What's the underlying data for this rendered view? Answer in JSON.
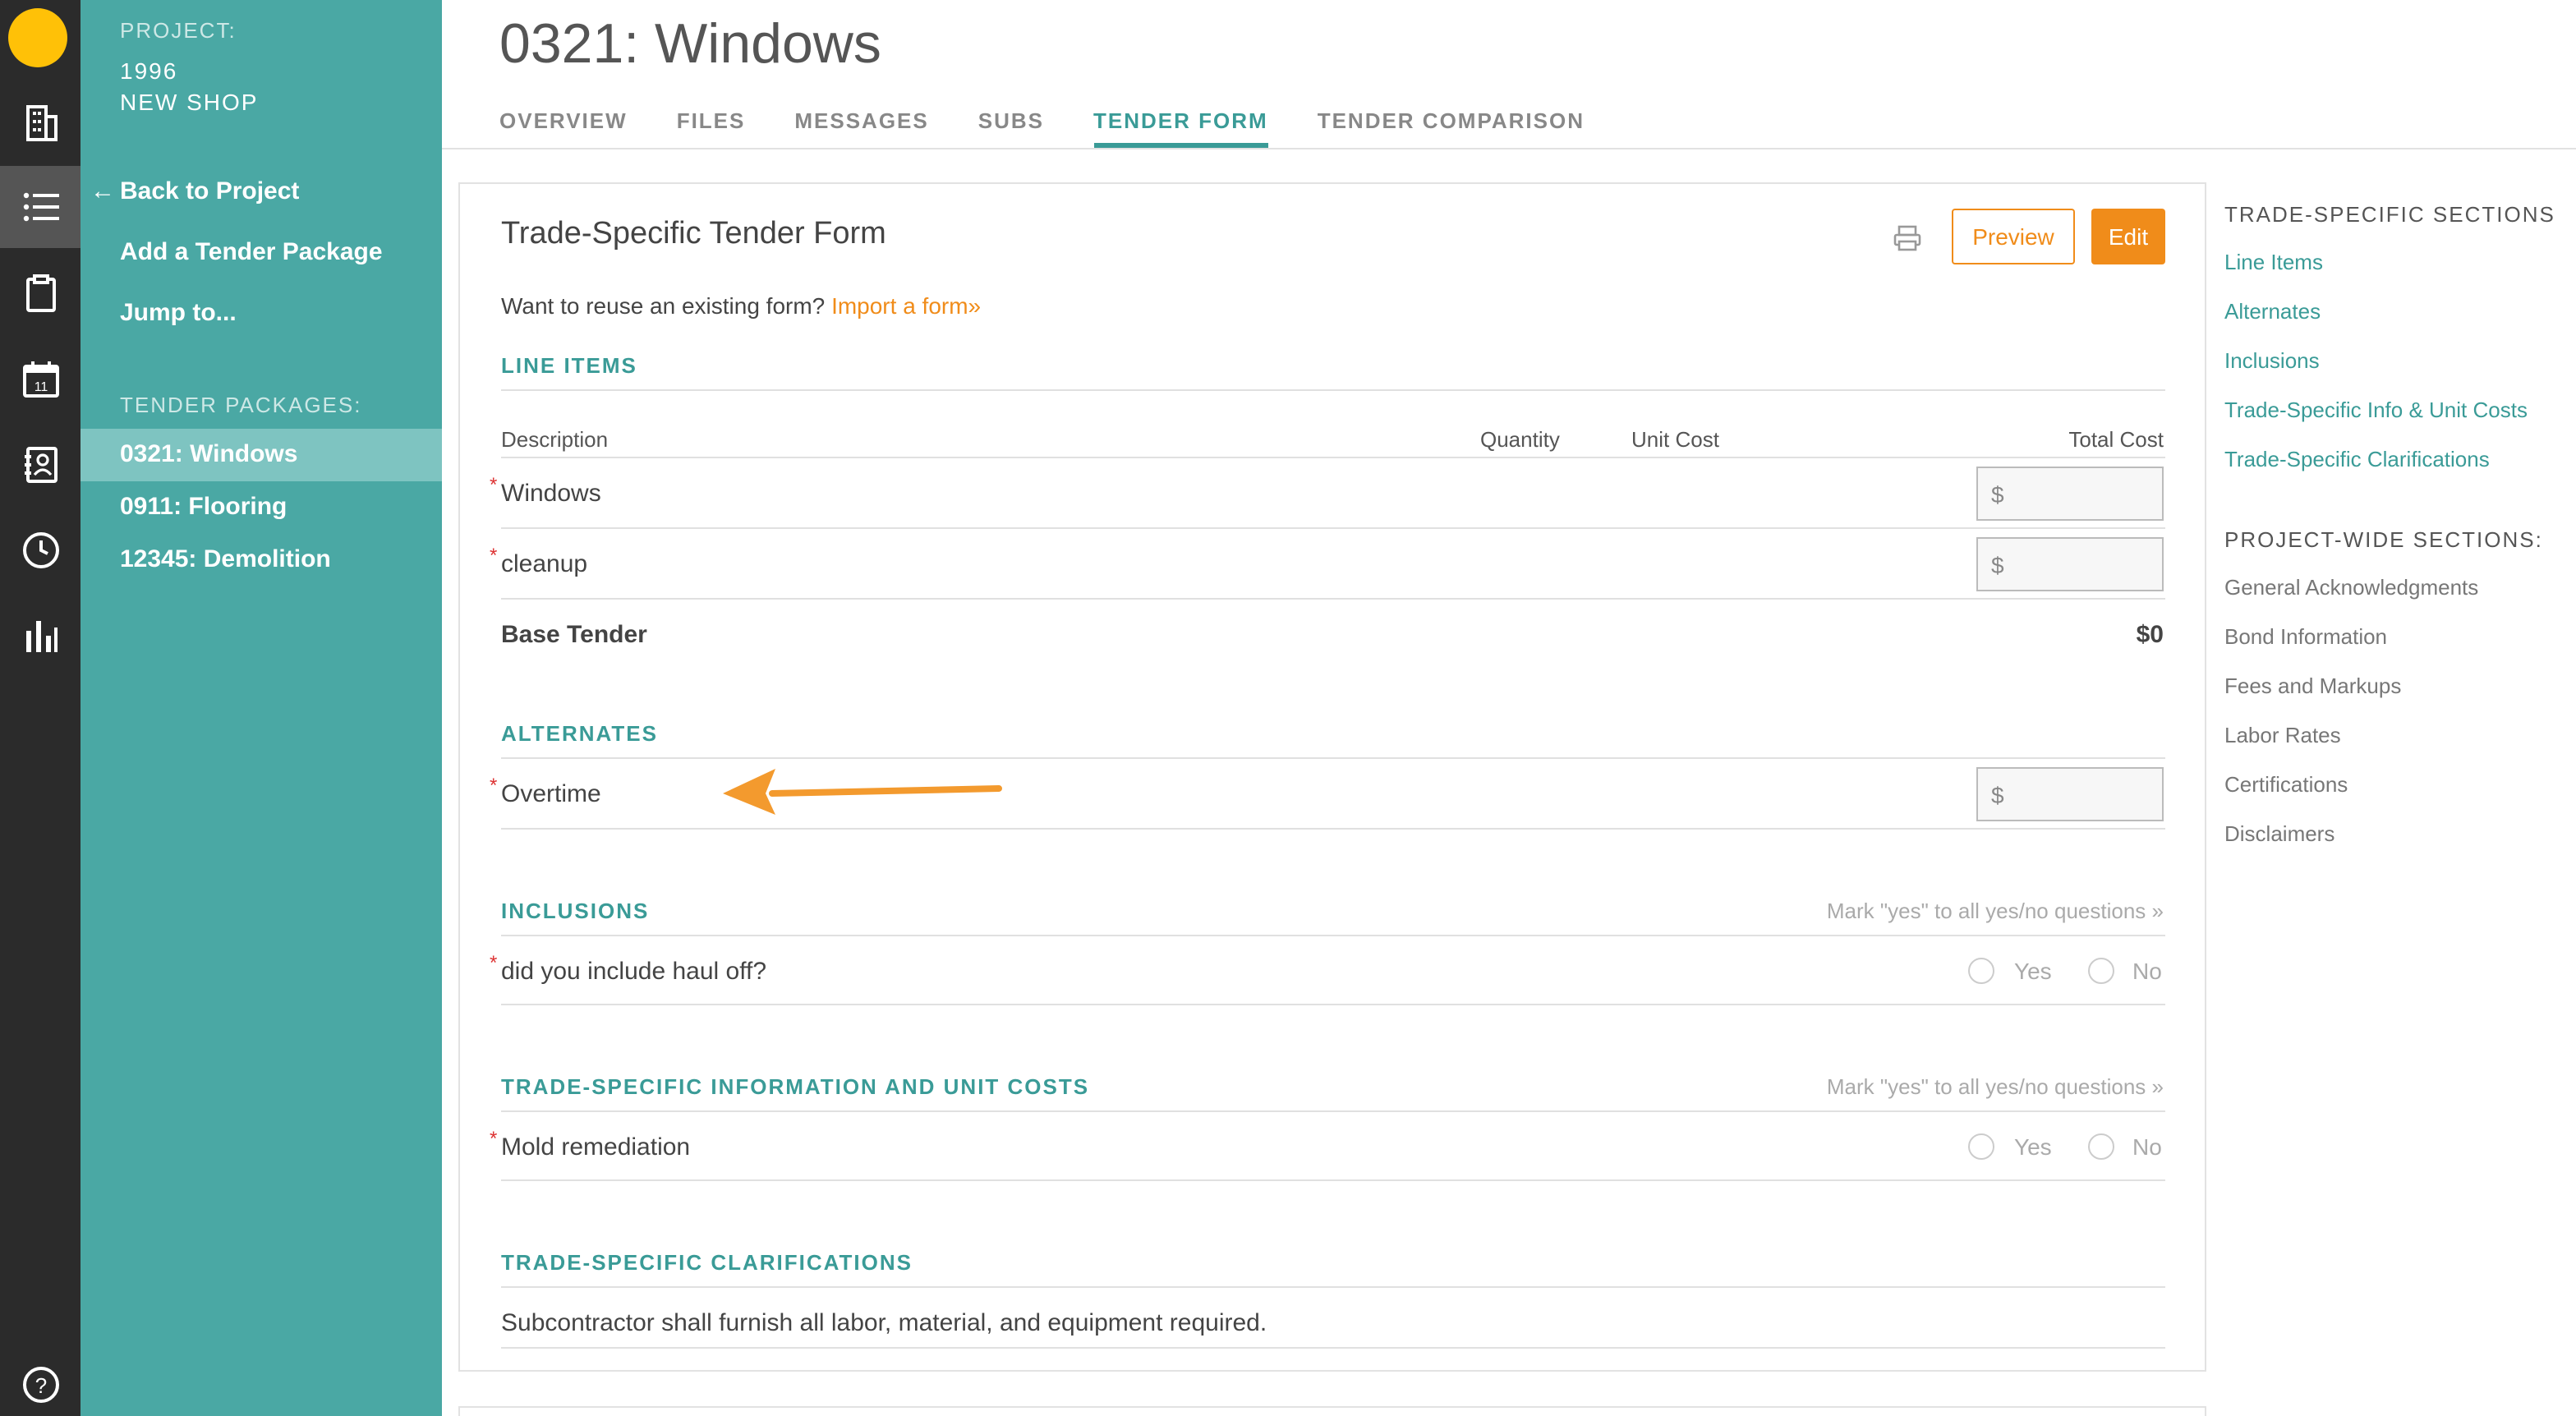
{
  "colors": {
    "rail": "#2b2b2b",
    "sidebar": "#4aa8a4",
    "accent": "#3a9b97",
    "orange": "#f08c1a",
    "logo": "#ffc107"
  },
  "rail": {
    "icons": [
      "building-icon",
      "list-icon",
      "clipboard-icon",
      "calendar-icon",
      "address-book-icon",
      "clock-icon",
      "bar-chart-icon",
      "help-icon"
    ],
    "calendar_day": "11"
  },
  "sidebar": {
    "project_label": "PROJECT:",
    "project_line1": "1996",
    "project_line2": "NEW SHOP",
    "back": "Back to Project",
    "add_package": "Add a Tender Package",
    "jump": "Jump to...",
    "packages_label": "TENDER PACKAGES:",
    "packages": [
      "0321: Windows",
      "0911: Flooring",
      "12345: Demolition"
    ]
  },
  "header": {
    "title": "0321: Windows",
    "tabs": [
      "OVERVIEW",
      "FILES",
      "MESSAGES",
      "SUBS",
      "TENDER FORM",
      "TENDER COMPARISON"
    ]
  },
  "form": {
    "title": "Trade-Specific Tender Form",
    "preview": "Preview",
    "edit": "Edit",
    "reuse_text": "Want to reuse an existing form?",
    "import_link": "Import a form»",
    "line_items": {
      "heading": "LINE ITEMS",
      "col_description": "Description",
      "col_quantity": "Quantity",
      "col_unit_cost": "Unit Cost",
      "col_total_cost": "Total Cost",
      "rows": [
        "Windows",
        "cleanup"
      ],
      "currency": "$",
      "base_label": "Base Tender",
      "base_value": "$0"
    },
    "alternates": {
      "heading": "ALTERNATES",
      "rows": [
        "Overtime"
      ]
    },
    "inclusions": {
      "heading": "INCLUSIONS",
      "mark_yes": "Mark \"yes\" to all yes/no questions »",
      "rows": [
        "did you include haul off?"
      ]
    },
    "trade_info": {
      "heading": "TRADE-SPECIFIC INFORMATION AND UNIT COSTS",
      "mark_yes": "Mark \"yes\" to all yes/no questions »",
      "rows": [
        "Mold remediation"
      ]
    },
    "clarifications": {
      "heading": "TRADE-SPECIFIC CLARIFICATIONS",
      "text": "Subcontractor shall furnish all labor, material, and equipment required."
    },
    "yes": "Yes",
    "no": "No",
    "required_mark": "*"
  },
  "right_nav": {
    "trade_heading": "TRADE-SPECIFIC SECTIONS",
    "trade_links": [
      "Line Items",
      "Alternates",
      "Inclusions",
      "Trade-Specific Info & Unit Costs",
      "Trade-Specific Clarifications"
    ],
    "project_heading": "PROJECT-WIDE SECTIONS:",
    "project_links": [
      "General Acknowledgments",
      "Bond Information",
      "Fees and Markups",
      "Labor Rates",
      "Certifications",
      "Disclaimers"
    ]
  }
}
